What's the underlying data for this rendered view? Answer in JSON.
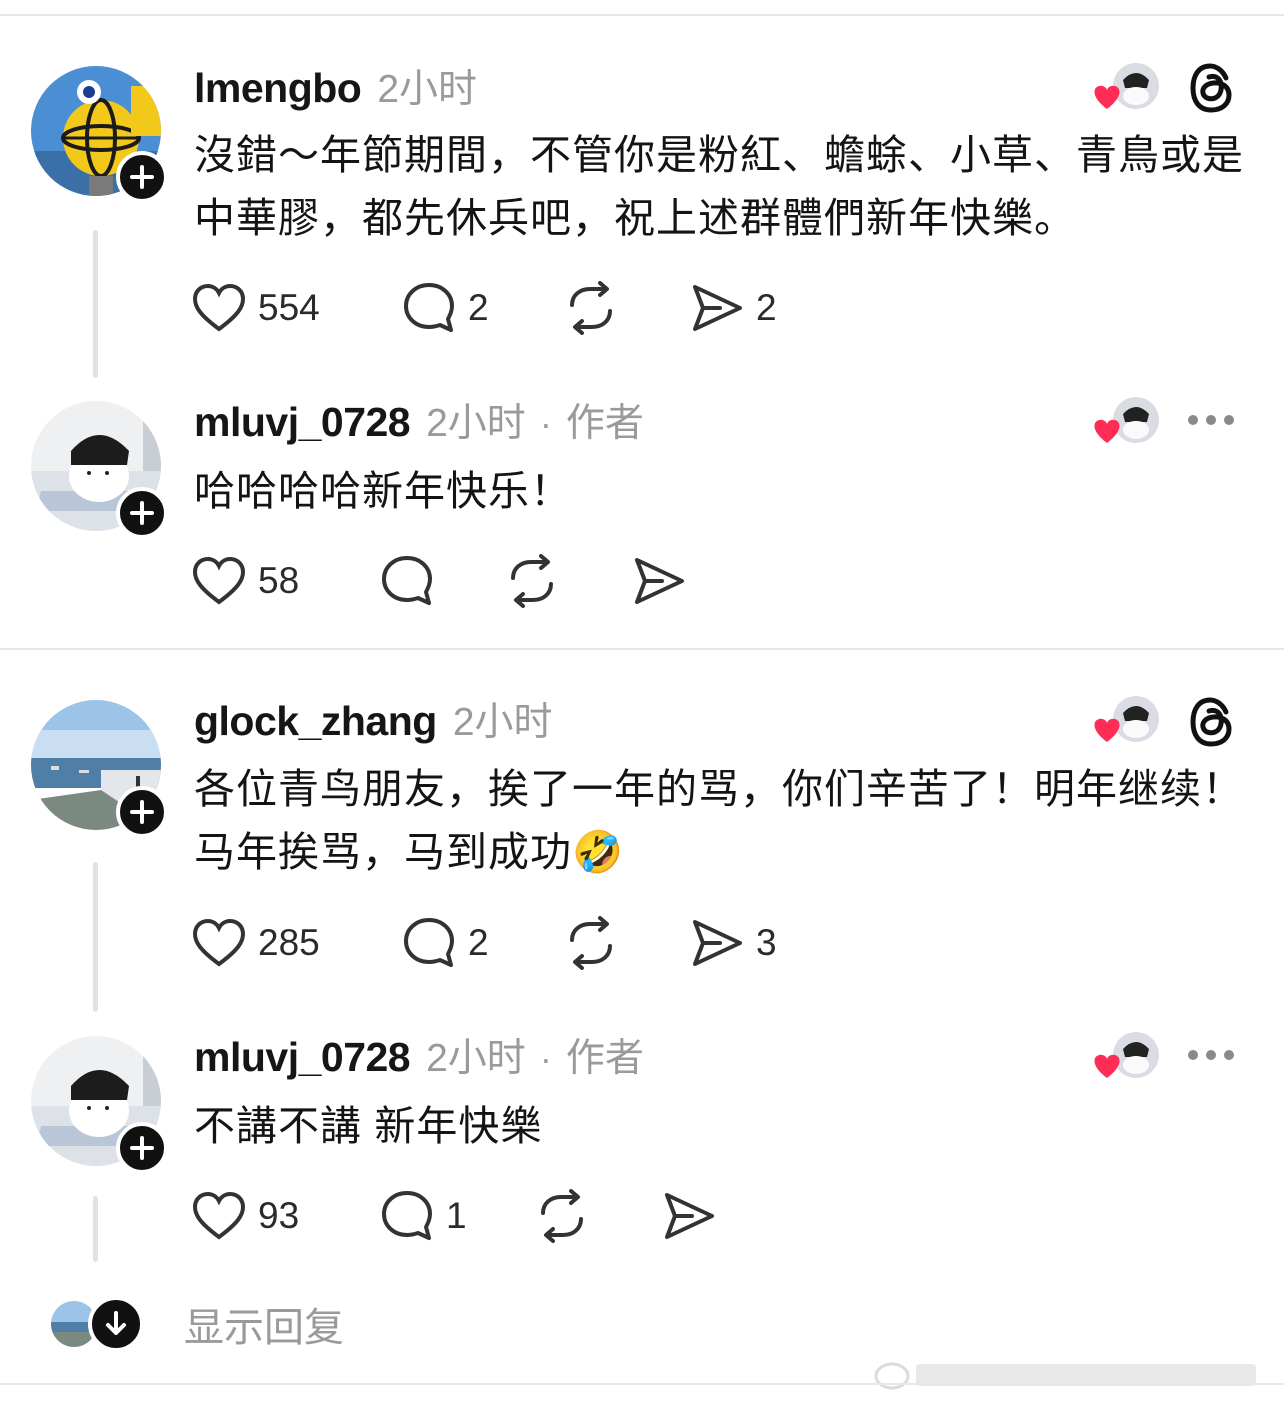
{
  "threads": [
    {
      "username": "lmengbo",
      "time": "2小时",
      "author_tag": "",
      "text": "沒錯～年節期間，不管你是粉紅、蟾蜍、小草、青鳥或是中華膠，都先休兵吧，祝上述群體們新年快樂。",
      "likes": "554",
      "replies": "2",
      "reposts": "",
      "shares": "2",
      "top_right_icon": "threads-logo-icon"
    },
    {
      "username": "mluvj_0728",
      "time": "2小时",
      "author_tag": "作者",
      "text": "哈哈哈哈新年快乐！",
      "likes": "58",
      "replies": "",
      "reposts": "",
      "shares": "",
      "top_right_icon": "more-icon"
    },
    {
      "username": "glock_zhang",
      "time": "2小时",
      "author_tag": "",
      "text": "各位青鸟朋友，挨了一年的骂，你们辛苦了！明年继续！马年挨骂，马到成功🤣",
      "likes": "285",
      "replies": "2",
      "reposts": "",
      "shares": "3",
      "top_right_icon": "threads-logo-icon"
    },
    {
      "username": "mluvj_0728",
      "time": "2小时",
      "author_tag": "作者",
      "text": "不講不講 新年快樂",
      "likes": "93",
      "replies": "1",
      "reposts": "",
      "shares": "",
      "top_right_icon": "more-icon"
    }
  ],
  "show_replies": {
    "label": "显示回复"
  },
  "colors": {
    "heart_red": "#ff2d55",
    "meta_grey": "#9a9a9a",
    "icon_dark": "#333333"
  }
}
